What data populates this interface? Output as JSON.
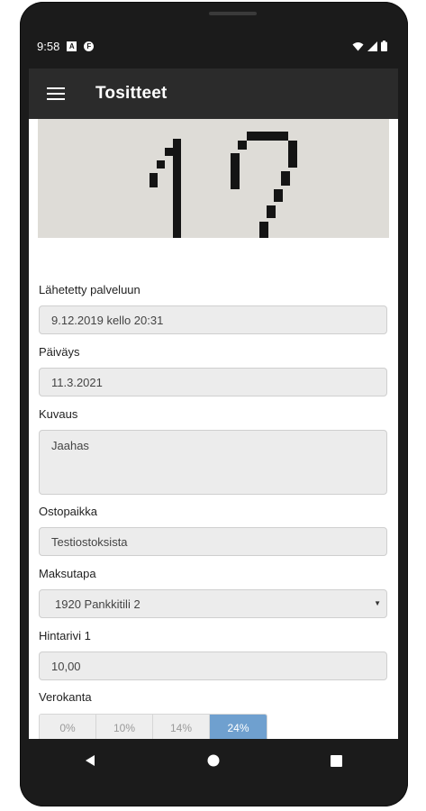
{
  "status_bar": {
    "time": "9:58",
    "badge_a": "A",
    "badge_f": "F",
    "icons": [
      "wifi-icon",
      "signal-icon",
      "battery-icon"
    ]
  },
  "app_bar": {
    "title": "Tositteet",
    "menu_icon": "hamburger-menu-icon"
  },
  "form": {
    "submitted_label": "Lähetetty palveluun",
    "submitted_value": "9.12.2019 kello 20:31",
    "date_label": "Päiväys",
    "date_value": "11.3.2021",
    "description_label": "Kuvaus",
    "description_value": "Jaahas",
    "store_label": "Ostopaikka",
    "store_value": "Testiostoksista",
    "payment_label": "Maksutapa",
    "payment_value": "1920 Pankkitili 2",
    "price_row_label": "Hintarivi 1",
    "price_row_value": "10,00",
    "vat_label": "Verokanta",
    "vat_options": [
      "0%",
      "10%",
      "14%",
      "24%"
    ],
    "vat_selected": "24%"
  },
  "colors": {
    "app_bar": "#2b2b2b",
    "accent_selected": "#6fa0cf",
    "field_bg": "#ececec"
  },
  "nav_bar": {
    "icons": [
      "back-icon",
      "home-icon",
      "recents-icon"
    ]
  }
}
